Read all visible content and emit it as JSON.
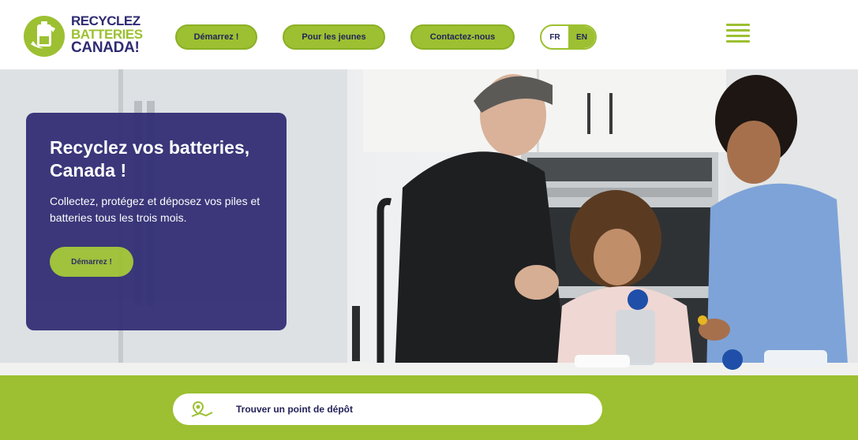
{
  "logo": {
    "line1": "RECYCLEZ",
    "line2": "BATTERIES",
    "line3": "CANADA!",
    "brand_green": "#9cc031",
    "brand_navy": "#2f2b73"
  },
  "nav": {
    "items": [
      {
        "label": "Démarrez !"
      },
      {
        "label": "Pour les jeunes"
      },
      {
        "label": "Contactez-nous"
      }
    ],
    "lang": {
      "fr": "FR",
      "en": "EN"
    },
    "menu_icon": "hamburger-menu-icon"
  },
  "hero": {
    "title": "Recyclez vos batteries, Canada !",
    "text": "Collectez, protégez et déposez vos piles et batteries tous les trois mois.",
    "cta": "Démarrez !"
  },
  "finder": {
    "label": "Trouver un point de dépôt",
    "icon": "map-pin-icon"
  }
}
